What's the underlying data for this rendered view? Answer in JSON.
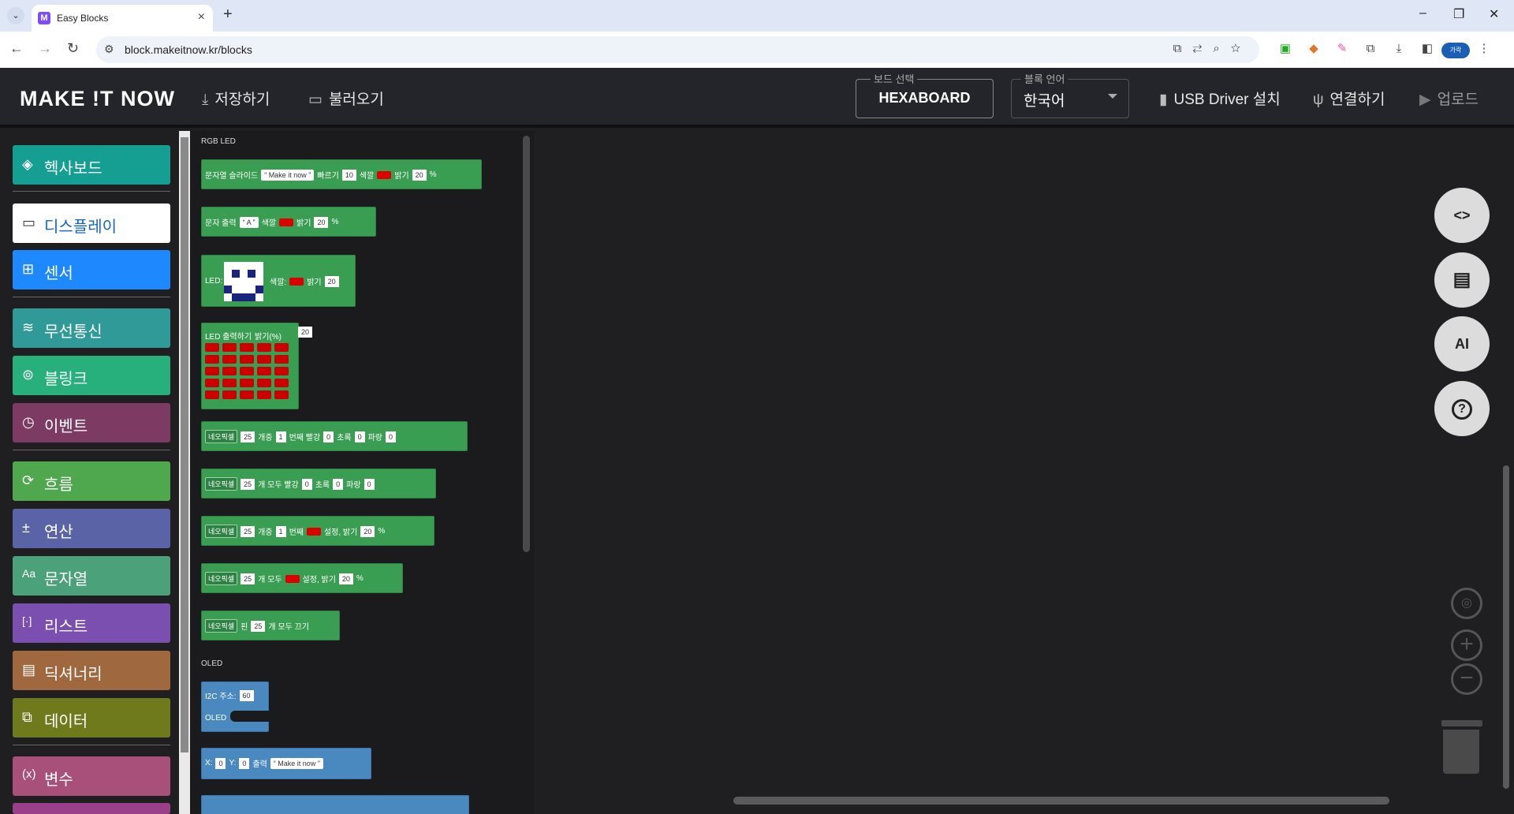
{
  "browser": {
    "tab_title": "Easy Blocks",
    "tab_favicon": "M",
    "url": "block.makeitnow.kr/blocks",
    "profile_label": "가락"
  },
  "header": {
    "logo": "MAKE !T NOW",
    "save": "저장하기",
    "open": "불러오기",
    "board_legend": "보드 선택",
    "board_value": "HEXABOARD",
    "lang_legend": "블록 언어",
    "lang_value": "한국어",
    "usb": "USB Driver 설치",
    "connect": "연결하기",
    "upload": "업로드"
  },
  "categories": [
    {
      "label": "헥사보드",
      "icon": "hexaboard-icon",
      "color": "#159e92"
    },
    {
      "label": "디스플레이",
      "icon": "display-icon",
      "color": "#ffffff"
    },
    {
      "label": "센서",
      "icon": "sensor-icon",
      "color": "#1e88ff"
    },
    {
      "label": "무선통신",
      "icon": "wifi-icon",
      "color": "#2f9a97"
    },
    {
      "label": "블링크",
      "icon": "blink-icon",
      "color": "#27b07c"
    },
    {
      "label": "이벤트",
      "icon": "clock-icon",
      "color": "#7d3a63"
    },
    {
      "label": "흐름",
      "icon": "loop-icon",
      "color": "#4fa84d"
    },
    {
      "label": "연산",
      "icon": "math-icon",
      "color": "#5a63a6"
    },
    {
      "label": "문자열",
      "icon": "text-icon",
      "color": "#4aa17a"
    },
    {
      "label": "리스트",
      "icon": "list-icon",
      "color": "#7a4fb0"
    },
    {
      "label": "딕셔너리",
      "icon": "dict-icon",
      "color": "#a0683f"
    },
    {
      "label": "데이터",
      "icon": "data-icon",
      "color": "#6e7a1c"
    },
    {
      "label": "변수",
      "icon": "variable-icon",
      "color": "#a8507a"
    }
  ],
  "flyout": {
    "section_rgb": "RGB LED",
    "section_oled": "OLED",
    "blocks": {
      "slide": {
        "a": "문자열 슬라이드",
        "text": "Make it now",
        "b": "빠르기",
        "speed": "10",
        "c": "색깔",
        "d": "밝기",
        "bright": "20",
        "e": "%"
      },
      "char": {
        "a": "문자 출력",
        "text": "A",
        "c": "색깔",
        "d": "밝기",
        "bright": "20",
        "e": "%"
      },
      "led": {
        "a": "LED:",
        "c": "색깔:",
        "d": "밝기",
        "bright": "20"
      },
      "ledout": {
        "a": "LED 출력하기",
        "b": "밝기(%)",
        "bright": "20"
      },
      "neo1": {
        "dd": "네오픽셀",
        "n": "25",
        "a": "개중",
        "idx": "1",
        "b": "번째 빨강",
        "r": "0",
        "c": "초록",
        "g": "0",
        "d": "파랑",
        "bl": "0"
      },
      "neo2": {
        "dd": "네오픽셀",
        "n": "25",
        "a": "개 모두 빨강",
        "r": "0",
        "c": "초록",
        "g": "0",
        "d": "파랑",
        "bl": "0"
      },
      "neo3": {
        "dd": "네오픽셀",
        "n": "25",
        "a": "개중",
        "idx": "1",
        "b": "번째",
        "c": "설정, 밝기",
        "bright": "20",
        "e": "%"
      },
      "neo4": {
        "dd": "네오픽셀",
        "n": "25",
        "a": "개 모두",
        "c": "설정, 밝기",
        "bright": "20",
        "e": "%"
      },
      "neo5": {
        "dd": "네오픽셀",
        "a": "핀",
        "n": "25",
        "b": "개 모두 끄기"
      },
      "oled1": {
        "a": "I2C 주소:",
        "addr": "60",
        "b": "OLED"
      },
      "oled2": {
        "x": "X:",
        "xv": "0",
        "y": "Y:",
        "yv": "0",
        "a": "출력",
        "text": "Make it now"
      }
    }
  },
  "fabs": {
    "code": "<>",
    "ai": "AI",
    "help": "?"
  }
}
